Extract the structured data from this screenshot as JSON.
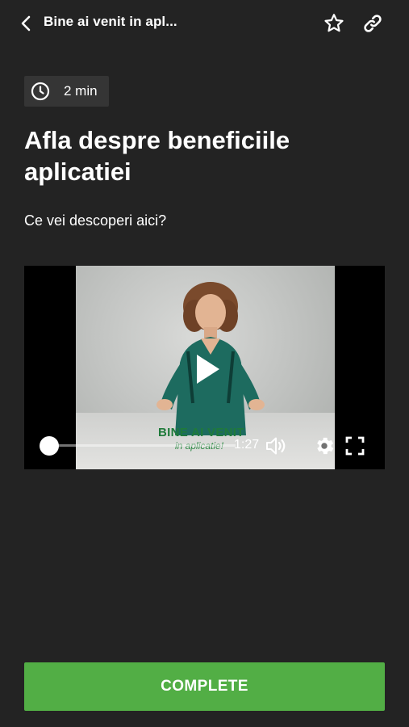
{
  "header": {
    "title": "Bine ai venit in apl...",
    "back_icon": "chevron-left-icon",
    "favorite_icon": "star-outline-icon",
    "share_icon": "link-icon"
  },
  "lesson": {
    "duration_icon": "clock-icon",
    "duration": "2 min",
    "title": "Afla despre beneficiile aplicatiei",
    "subtitle": "Ce vei descoperi aici?"
  },
  "video": {
    "caption_main": "BINE AI VENIT",
    "caption_sub": "in aplicatie!",
    "time": "1:27",
    "progress": 0.0,
    "play_icon": "play-icon",
    "volume_icon": "volume-icon",
    "settings_icon": "gear-icon",
    "fullscreen_icon": "fullscreen-icon"
  },
  "actions": {
    "complete_label": "COMPLETE"
  },
  "colors": {
    "background": "#232323",
    "badge_background": "#353535",
    "accent": "#52ae45",
    "caption_green": "#1f7a3a"
  }
}
